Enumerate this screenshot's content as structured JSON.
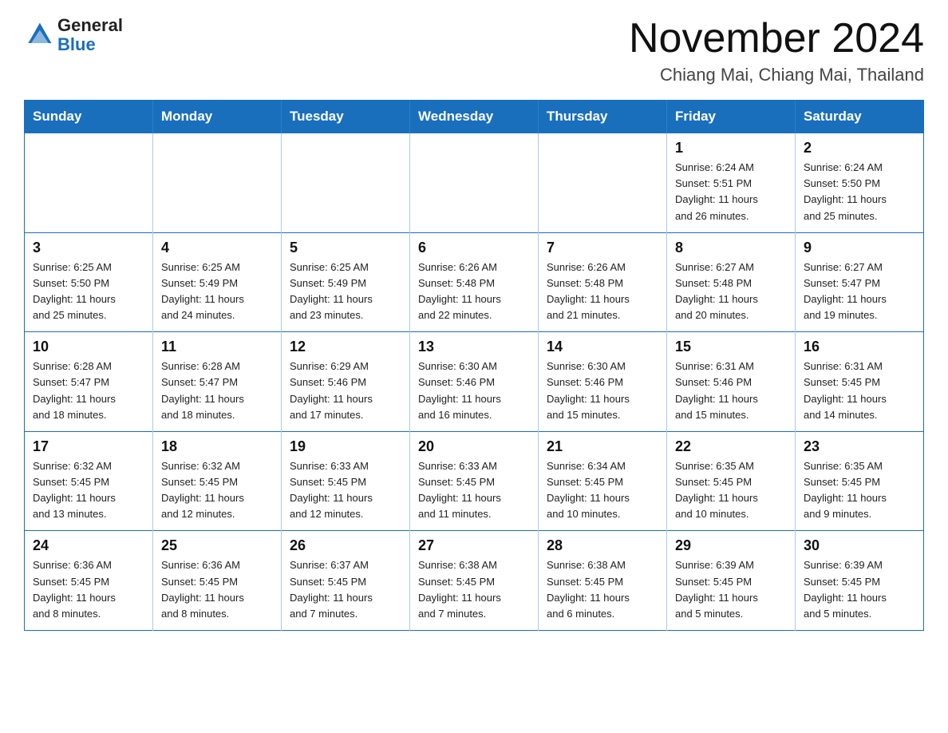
{
  "header": {
    "logo_general": "General",
    "logo_blue": "Blue",
    "month_title": "November 2024",
    "location": "Chiang Mai, Chiang Mai, Thailand"
  },
  "weekdays": [
    "Sunday",
    "Monday",
    "Tuesday",
    "Wednesday",
    "Thursday",
    "Friday",
    "Saturday"
  ],
  "weeks": [
    [
      {
        "day": "",
        "info": ""
      },
      {
        "day": "",
        "info": ""
      },
      {
        "day": "",
        "info": ""
      },
      {
        "day": "",
        "info": ""
      },
      {
        "day": "",
        "info": ""
      },
      {
        "day": "1",
        "info": "Sunrise: 6:24 AM\nSunset: 5:51 PM\nDaylight: 11 hours\nand 26 minutes."
      },
      {
        "day": "2",
        "info": "Sunrise: 6:24 AM\nSunset: 5:50 PM\nDaylight: 11 hours\nand 25 minutes."
      }
    ],
    [
      {
        "day": "3",
        "info": "Sunrise: 6:25 AM\nSunset: 5:50 PM\nDaylight: 11 hours\nand 25 minutes."
      },
      {
        "day": "4",
        "info": "Sunrise: 6:25 AM\nSunset: 5:49 PM\nDaylight: 11 hours\nand 24 minutes."
      },
      {
        "day": "5",
        "info": "Sunrise: 6:25 AM\nSunset: 5:49 PM\nDaylight: 11 hours\nand 23 minutes."
      },
      {
        "day": "6",
        "info": "Sunrise: 6:26 AM\nSunset: 5:48 PM\nDaylight: 11 hours\nand 22 minutes."
      },
      {
        "day": "7",
        "info": "Sunrise: 6:26 AM\nSunset: 5:48 PM\nDaylight: 11 hours\nand 21 minutes."
      },
      {
        "day": "8",
        "info": "Sunrise: 6:27 AM\nSunset: 5:48 PM\nDaylight: 11 hours\nand 20 minutes."
      },
      {
        "day": "9",
        "info": "Sunrise: 6:27 AM\nSunset: 5:47 PM\nDaylight: 11 hours\nand 19 minutes."
      }
    ],
    [
      {
        "day": "10",
        "info": "Sunrise: 6:28 AM\nSunset: 5:47 PM\nDaylight: 11 hours\nand 18 minutes."
      },
      {
        "day": "11",
        "info": "Sunrise: 6:28 AM\nSunset: 5:47 PM\nDaylight: 11 hours\nand 18 minutes."
      },
      {
        "day": "12",
        "info": "Sunrise: 6:29 AM\nSunset: 5:46 PM\nDaylight: 11 hours\nand 17 minutes."
      },
      {
        "day": "13",
        "info": "Sunrise: 6:30 AM\nSunset: 5:46 PM\nDaylight: 11 hours\nand 16 minutes."
      },
      {
        "day": "14",
        "info": "Sunrise: 6:30 AM\nSunset: 5:46 PM\nDaylight: 11 hours\nand 15 minutes."
      },
      {
        "day": "15",
        "info": "Sunrise: 6:31 AM\nSunset: 5:46 PM\nDaylight: 11 hours\nand 15 minutes."
      },
      {
        "day": "16",
        "info": "Sunrise: 6:31 AM\nSunset: 5:45 PM\nDaylight: 11 hours\nand 14 minutes."
      }
    ],
    [
      {
        "day": "17",
        "info": "Sunrise: 6:32 AM\nSunset: 5:45 PM\nDaylight: 11 hours\nand 13 minutes."
      },
      {
        "day": "18",
        "info": "Sunrise: 6:32 AM\nSunset: 5:45 PM\nDaylight: 11 hours\nand 12 minutes."
      },
      {
        "day": "19",
        "info": "Sunrise: 6:33 AM\nSunset: 5:45 PM\nDaylight: 11 hours\nand 12 minutes."
      },
      {
        "day": "20",
        "info": "Sunrise: 6:33 AM\nSunset: 5:45 PM\nDaylight: 11 hours\nand 11 minutes."
      },
      {
        "day": "21",
        "info": "Sunrise: 6:34 AM\nSunset: 5:45 PM\nDaylight: 11 hours\nand 10 minutes."
      },
      {
        "day": "22",
        "info": "Sunrise: 6:35 AM\nSunset: 5:45 PM\nDaylight: 11 hours\nand 10 minutes."
      },
      {
        "day": "23",
        "info": "Sunrise: 6:35 AM\nSunset: 5:45 PM\nDaylight: 11 hours\nand 9 minutes."
      }
    ],
    [
      {
        "day": "24",
        "info": "Sunrise: 6:36 AM\nSunset: 5:45 PM\nDaylight: 11 hours\nand 8 minutes."
      },
      {
        "day": "25",
        "info": "Sunrise: 6:36 AM\nSunset: 5:45 PM\nDaylight: 11 hours\nand 8 minutes."
      },
      {
        "day": "26",
        "info": "Sunrise: 6:37 AM\nSunset: 5:45 PM\nDaylight: 11 hours\nand 7 minutes."
      },
      {
        "day": "27",
        "info": "Sunrise: 6:38 AM\nSunset: 5:45 PM\nDaylight: 11 hours\nand 7 minutes."
      },
      {
        "day": "28",
        "info": "Sunrise: 6:38 AM\nSunset: 5:45 PM\nDaylight: 11 hours\nand 6 minutes."
      },
      {
        "day": "29",
        "info": "Sunrise: 6:39 AM\nSunset: 5:45 PM\nDaylight: 11 hours\nand 5 minutes."
      },
      {
        "day": "30",
        "info": "Sunrise: 6:39 AM\nSunset: 5:45 PM\nDaylight: 11 hours\nand 5 minutes."
      }
    ]
  ]
}
